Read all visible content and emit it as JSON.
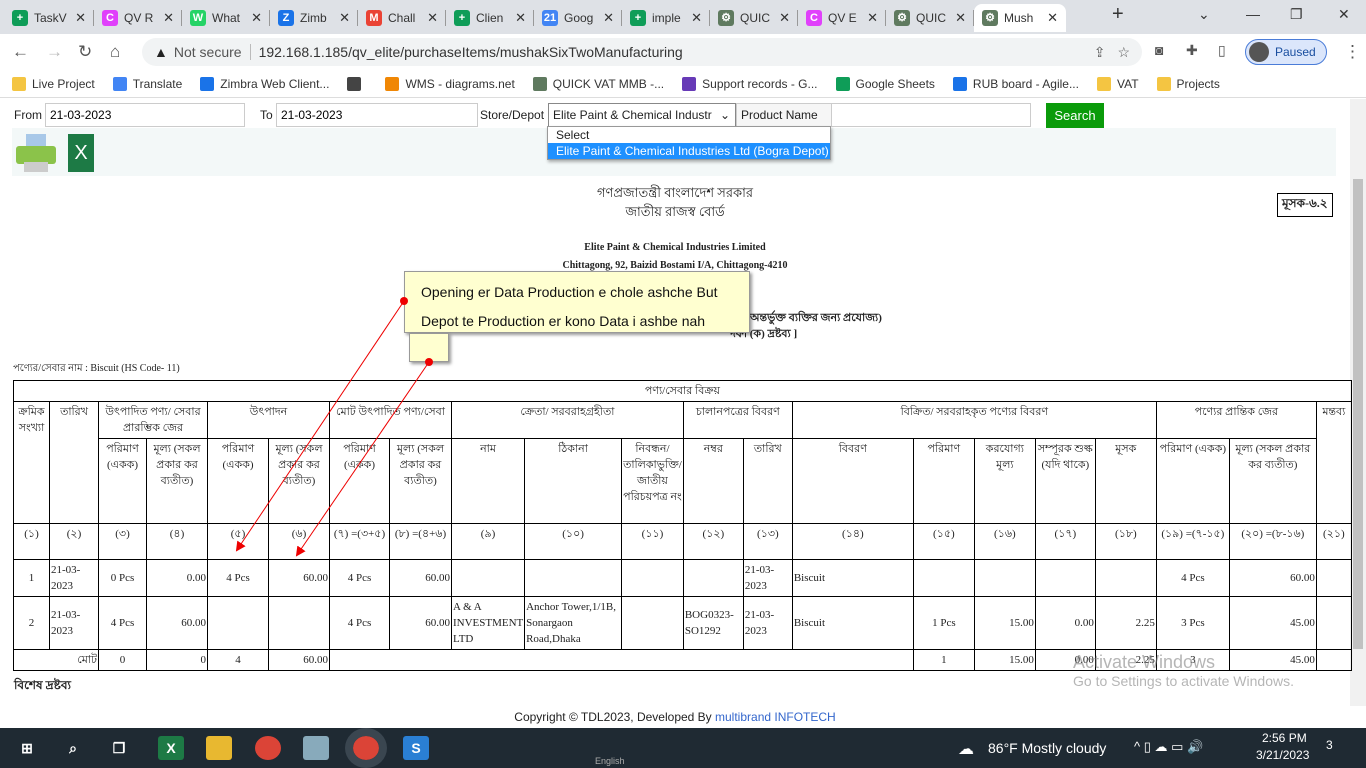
{
  "browser": {
    "tabs": [
      {
        "label": "TaskV",
        "color": "#0f9d58",
        "glyph": "+"
      },
      {
        "label": "QV R",
        "color": "#e040fb",
        "glyph": "C"
      },
      {
        "label": "What",
        "color": "#25d366",
        "glyph": "W"
      },
      {
        "label": "Zimb",
        "color": "#1a73e8",
        "glyph": "Z"
      },
      {
        "label": "Chall",
        "color": "#ea4335",
        "glyph": "M"
      },
      {
        "label": "Clien",
        "color": "#0f9d58",
        "glyph": "+"
      },
      {
        "label": "Goog",
        "color": "#4285f4",
        "glyph": "21"
      },
      {
        "label": "imple",
        "color": "#0f9d58",
        "glyph": "+"
      },
      {
        "label": "QUIC",
        "color": "#5f7a5f",
        "glyph": "⚙"
      },
      {
        "label": "QV E",
        "color": "#e040fb",
        "glyph": "C"
      },
      {
        "label": "QUIC",
        "color": "#5f7a5f",
        "glyph": "⚙"
      },
      {
        "label": "Mush",
        "color": "#5f7a5f",
        "glyph": "⚙"
      }
    ],
    "not_secure": "Not secure",
    "url": "192.168.1.185/qv_elite/purchaseItems/mushakSixTwoManufacturing",
    "profile": "Paused",
    "bookmarks": [
      {
        "label": "Live Project",
        "color": "#f4c542"
      },
      {
        "label": "Translate",
        "color": "#4285f4"
      },
      {
        "label": "Zimbra Web Client...",
        "color": "#1a73e8"
      },
      {
        "label": "",
        "color": "#444"
      },
      {
        "label": "WMS - diagrams.net",
        "color": "#f08705"
      },
      {
        "label": "QUICK VAT MMB -...",
        "color": "#5f7a5f"
      },
      {
        "label": "Support records - G...",
        "color": "#673ab7"
      },
      {
        "label": "Google Sheets",
        "color": "#0f9d58"
      },
      {
        "label": "RUB board - Agile...",
        "color": "#1a73e8"
      },
      {
        "label": "VAT",
        "color": "#f4c542"
      },
      {
        "label": "Projects",
        "color": "#f4c542"
      }
    ]
  },
  "filters": {
    "from_label": "From",
    "from_value": "21-03-2023",
    "to_label": "To",
    "to_value": "21-03-2023",
    "store_label": "Store/Depot",
    "store_value": "Elite Paint & Chemical Industr",
    "product_label": "Product Name",
    "product_value": "",
    "search": "Search",
    "options": [
      "Select",
      "Elite Paint & Chemical Industries Ltd (Bogra Depot)"
    ]
  },
  "report": {
    "gov": "গণপ্রজাতন্ত্রী বাংলাদেশ সরকার",
    "nbr": "জাতীয় রাজস্ব বোর্ড",
    "form_no": "মূসক-৬.২",
    "company": "Elite Paint & Chemical Industries Limited",
    "address": "Chittagong, 92, Baizid Bostami I/A, Chittagong-4210",
    "sub1": "অন্তর্ভুক্ত ব্যক্তির জন্য প্রযোজ্য)",
    "sub2": "দফা (ক) দ্রষ্টব্য ]",
    "product": "পণ্যের/সেবার নাম : Biscuit (HS Code- 11)",
    "title_row": "পণ্য/সেবার বিক্রয়",
    "groups": [
      "ক্রমিক সংখ্যা",
      "তারিখ",
      "উৎপাদিত পণ্য/ সেবার প্রারম্ভিক জের",
      "উৎপাদন",
      "মোট উৎপাদিত পণ্য/সেবা",
      "ক্রেতা/ সরবরাহগ্রহীতা",
      "চালানপত্রের বিবরণ",
      "বিক্রিত/ সরবরাহকৃত পণ্যের বিবরণ",
      "পণ্যের প্রান্তিক জের",
      "মন্তব্য"
    ],
    "subs": [
      "পরিমাণ (একক)",
      "মূল্য (সকল প্রকার কর ব্যতীত)",
      "পরিমাণ (একক)",
      "মূল্য (সকল প্রকার কর ব্যতীত)",
      "পরিমাণ (একক)",
      "মূল্য (সকল প্রকার কর ব্যতীত)",
      "নাম",
      "ঠিকানা",
      "নিবন্ধন/ তালিকাভুক্তি/ জাতীয় পরিচয়পত্র নং",
      "নম্বর",
      "তারিখ",
      "বিবরণ",
      "পরিমাণ",
      "করযোগ্য মূল্য",
      "সম্পূরক শুল্ক (যদি থাকে)",
      "মূসক",
      "পরিমাণ (একক)",
      "মূল্য (সকল প্রকার কর ব্যতীত)"
    ],
    "nums": [
      "(১)",
      "(২)",
      "(৩)",
      "(৪)",
      "(৫)",
      "(৬)",
      "(৭) =(৩+৫)",
      "(৮) =(৪+৬)",
      "(৯)",
      "(১০)",
      "(১১)",
      "(১২)",
      "(১৩)",
      "(১৪)",
      "(১৫)",
      "(১৬)",
      "(১৭)",
      "(১৮)",
      "(১৯) =(৭-১৫)",
      "(২০) =(৮-১৬)",
      "(২১)"
    ],
    "rows": [
      [
        "1",
        "21-03-2023",
        "0 Pcs",
        "0.00",
        "4 Pcs",
        "60.00",
        "4 Pcs",
        "60.00",
        "",
        "",
        "",
        "",
        "21-03-2023",
        "Biscuit",
        "",
        "",
        "",
        "",
        "4 Pcs",
        "60.00",
        ""
      ],
      [
        "2",
        "21-03-2023",
        "4 Pcs",
        "60.00",
        "",
        "",
        "4 Pcs",
        "60.00",
        "A & A INVESTMENT LTD",
        "Anchor Tower,1/1B, Sonargaon Road,Dhaka",
        "",
        "BOG0323-SO1292",
        "21-03-2023",
        "Biscuit",
        "1 Pcs",
        "15.00",
        "0.00",
        "2.25",
        "3 Pcs",
        "45.00",
        ""
      ]
    ],
    "total": {
      "label": "মোট",
      "c3": "0",
      "c4": "0",
      "c5": "4",
      "c6": "60.00",
      "c15": "1",
      "c16": "15.00",
      "c17": "0.00",
      "c18": "2.25",
      "c19": "3",
      "c20": "45.00"
    },
    "note_heading": "বিশেষ দ্রষ্টব্য"
  },
  "annotation": {
    "line1": "Opening er Data Production e chole ashche But",
    "line2": "Depot te Production er kono Data i ashbe nah"
  },
  "footer": {
    "text": "Copyright © TDL2023, Developed By ",
    "link": "multibrand INFOTECH"
  },
  "watermark": {
    "line1": "Activate Windows",
    "line2": "Go to Settings to activate Windows."
  },
  "taskbar": {
    "weather": "86°F  Mostly cloudy",
    "time": "2:56 PM",
    "date": "3/21/2023",
    "notif": "3",
    "lang": "English"
  }
}
